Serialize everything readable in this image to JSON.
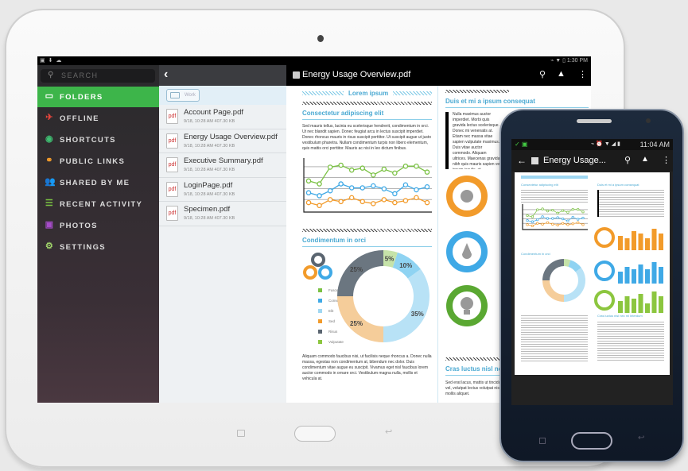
{
  "tablet": {
    "status_time": "1:30 PM",
    "status_left_icons": "▣ ⬇ ☁",
    "status_right_icons": "⌁ ▼ ▯",
    "sidebar": {
      "search_placeholder": "SEARCH",
      "items": [
        {
          "label": "FOLDERS",
          "icon": "folder-icon",
          "glyph": "▭",
          "color": "#ffffff",
          "active": true
        },
        {
          "label": "OFFLINE",
          "icon": "airplane-icon",
          "glyph": "✈",
          "color": "#e8453c",
          "active": false
        },
        {
          "label": "SHORTCUTS",
          "icon": "shortcut-icon",
          "glyph": "◉",
          "color": "#3fbf72",
          "active": false
        },
        {
          "label": "PUBLIC LINKS",
          "icon": "link-icon",
          "glyph": "⚭",
          "color": "#f29b2b",
          "active": false
        },
        {
          "label": "SHARED BY ME",
          "icon": "shared-users-icon",
          "glyph": "👥",
          "color": "#3fa9e6",
          "active": false
        },
        {
          "label": "RECENT ACTIVITY",
          "icon": "list-icon",
          "glyph": "☰",
          "color": "#7ac143",
          "active": false
        },
        {
          "label": "PHOTOS",
          "icon": "photo-icon",
          "glyph": "▣",
          "color": "#a64cc9",
          "active": false
        },
        {
          "label": "SETTINGS",
          "icon": "gear-icon",
          "glyph": "⚙",
          "color": "#9fd36a",
          "active": false
        }
      ]
    },
    "filelist": {
      "folder_chip": "Work",
      "files": [
        {
          "name": "Account Page.pdf",
          "meta": "9/18, 10:28 AM   407.30 KB"
        },
        {
          "name": "Energy Usage Overview.pdf",
          "meta": "9/18, 10:28 AM   407.30 KB"
        },
        {
          "name": "Executive Summary.pdf",
          "meta": "9/18, 10:28 AM   407.30 KB"
        },
        {
          "name": "LoginPage.pdf",
          "meta": "9/18, 10:28 AM   407.30 KB"
        },
        {
          "name": "Specimen.pdf",
          "meta": "9/18, 10:28 AM   407.30 KB"
        }
      ],
      "pdf_label": "pdf"
    },
    "viewer": {
      "title": "Energy Usage Overview.pdf",
      "doc": {
        "banner": "Lorem ipsum",
        "h1": "Consectetur adipiscing elit",
        "p1": "Sed mauris tellus, lacinia eu scelerisque hendrerit, condimentum in orci. Ut nec blandit sapien. Donec feugiat arcu in lectus suscipit imperdiet. Donec rhoncus mauris in risus suscipit porttitor. Ut suscipit augue ut justo vestibulum pharetra. Nullam condimentum turpis non libero elementum, quis mattis orci porttitor. Mauris ac nisi in leo dictum finibus.",
        "h2": "Condimentum in orci",
        "legend": [
          {
            "label": "Fusce",
            "color": "#7ac143"
          },
          {
            "label": "Consequat",
            "color": "#3fa9e6"
          },
          {
            "label": "Elit",
            "color": "#9fd7f2"
          },
          {
            "label": "Sed",
            "color": "#f29b2b"
          },
          {
            "label": "Risus",
            "color": "#5a6570"
          },
          {
            "label": "Vulputate",
            "color": "#8cc63f"
          }
        ],
        "donut": [
          {
            "label": "5%",
            "value": 5,
            "color": "#c6e3a9"
          },
          {
            "label": "10%",
            "value": 10,
            "color": "#8fd3f2"
          },
          {
            "label": "35%",
            "value": 35,
            "color": "#b8e2f6"
          },
          {
            "label": "25%",
            "value": 25,
            "color": "#f5cd9a"
          },
          {
            "label": "25%",
            "value": 25,
            "color": "#6b7680"
          }
        ],
        "p2": "Aliquam commodo faucibus nisi, ut facilisis neque rhoncus a. Donec nulla massa, egestas non condimentum at, bibendum nec dolor. Duis condimentum vitae augue eu suscipit. Vivamus eget nisl faucibus lorem auctor commodo in ornare orci. Vestibulum magna nulla, mollis et vehicula at.",
        "h3": "Duis et mi a ipsum consequat",
        "p3": "Nulla maximus auctor imperdiet. Morbi quis gravida lectus scelerisque. Donec mi venenatis at. Etiam nec massa vitae sapien vulputate maximus. Duis vitae auctor commodo. Aliquam ultrices. Maecenas gravida nibh quis mauris sapien vel ipsum iaculis, at condimentum ultrices, mi sit amet euismod faucibus erat nibh at ante. Donec. Praesent ac varius ipsum.",
        "h4": "Cras luctus nisl nec mi interdum",
        "p4": "Sed erat lacus, mattis ut tincidunt vel, volutpat lectus volutpat nisl mollis aliquet."
      },
      "line_chart": {
        "type": "line",
        "series": [
          {
            "name": "green",
            "color": "#7ac143",
            "values": [
              3.0,
              2.7,
              4.4,
              4.6,
              4.1,
              4.3,
              3.6,
              4.2,
              3.8,
              4.5,
              4.5,
              3.9
            ]
          },
          {
            "name": "blue",
            "color": "#3fa9e6",
            "values": [
              1.8,
              1.5,
              2.0,
              2.7,
              2.3,
              2.3,
              2.5,
              2.2,
              1.7,
              2.6,
              2.1,
              2.4
            ]
          },
          {
            "name": "orange",
            "color": "#f29b2b",
            "values": [
              0.8,
              0.5,
              1.1,
              0.9,
              1.3,
              0.9,
              0.7,
              1.1,
              0.8,
              1.0,
              1.3,
              0.8
            ]
          }
        ],
        "ylim": [
          0,
          5
        ]
      }
    }
  },
  "phone": {
    "status_time": "11:04 AM",
    "status_icons": "⌁ ⏰ ▼ ◢ ▮",
    "title": "Energy Usage...",
    "doc_banner": "Lorem ipsum",
    "doc_h1": "Consectetur adipiscing elit",
    "doc_h2": "Condimentum in orci",
    "doc_h3": "Duis et mi a ipsum consequat",
    "doc_h4": "Cras luctus nisl nec mi interdum"
  }
}
